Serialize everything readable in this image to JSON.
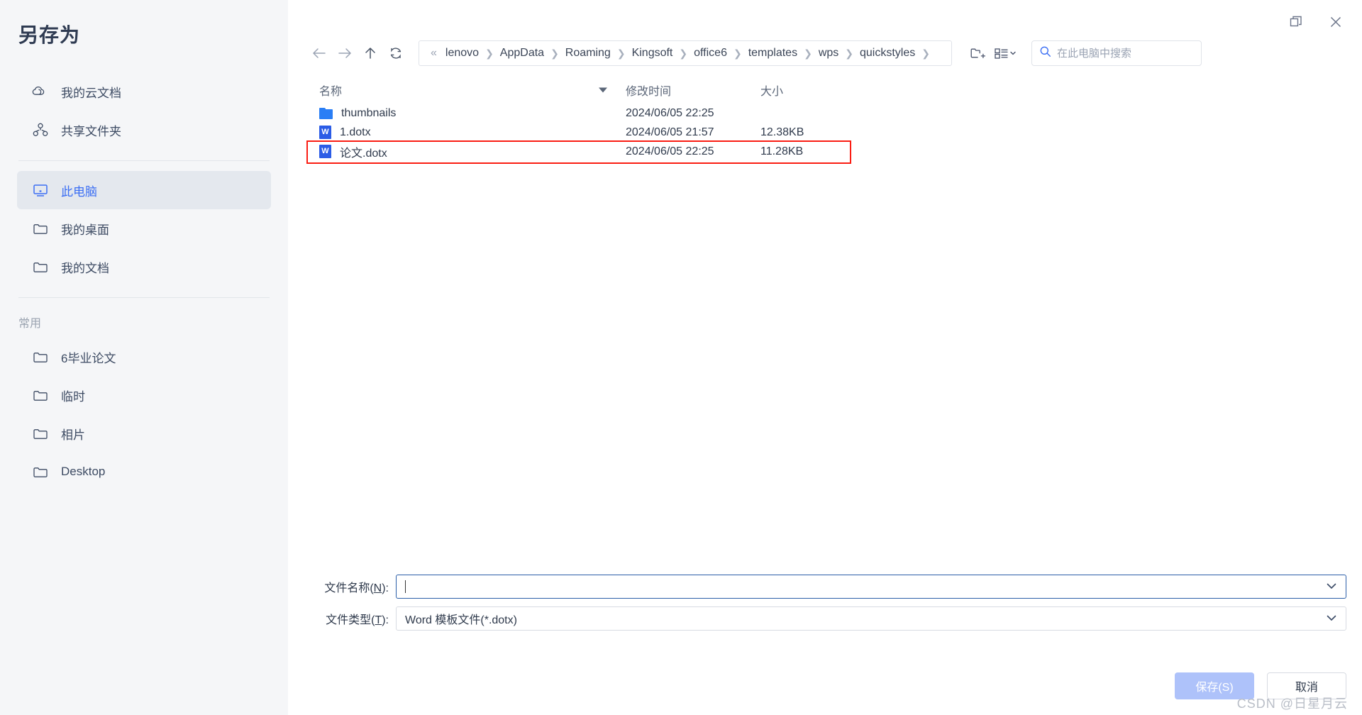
{
  "sidebar": {
    "title": "另存为",
    "top_items": [
      {
        "label": "我的云文档",
        "icon": "cloud-icon"
      },
      {
        "label": "共享文件夹",
        "icon": "share-nodes-icon"
      }
    ],
    "location_items": [
      {
        "label": "此电脑",
        "icon": "monitor-icon",
        "selected": true
      },
      {
        "label": "我的桌面",
        "icon": "folder-icon",
        "selected": false
      },
      {
        "label": "我的文档",
        "icon": "folder-icon",
        "selected": false
      }
    ],
    "section_label": "常用",
    "common_items": [
      {
        "label": "6毕业论文",
        "icon": "folder-icon"
      },
      {
        "label": "临时",
        "icon": "folder-icon"
      },
      {
        "label": "相片",
        "icon": "folder-icon"
      },
      {
        "label": "Desktop",
        "icon": "folder-icon"
      }
    ]
  },
  "window": {
    "restore_title": "还原",
    "close_title": "关闭"
  },
  "toolbar": {
    "back_title": "后退",
    "forward_title": "前进",
    "up_title": "向上",
    "refresh_title": "刷新",
    "crumb_prefix": "«",
    "breadcrumbs": [
      "lenovo",
      "AppData",
      "Roaming",
      "Kingsoft",
      "office6",
      "templates",
      "wps",
      "quickstyles"
    ],
    "new_folder_title": "新建文件夹",
    "view_title": "查看方式"
  },
  "search": {
    "placeholder": "在此电脑中搜索",
    "value": ""
  },
  "file_list": {
    "columns": {
      "name": "名称",
      "modified": "修改时间",
      "size": "大小"
    },
    "rows": [
      {
        "name": "thumbnails",
        "modified": "2024/06/05 22:25",
        "size": "",
        "icon": "folder-icon",
        "highlight": false
      },
      {
        "name": "1.dotx",
        "modified": "2024/06/05 21:57",
        "size": "12.38KB",
        "icon": "word-file-icon",
        "highlight": false
      },
      {
        "name": "论文.dotx",
        "modified": "2024/06/05 22:25",
        "size": "11.28KB",
        "icon": "word-file-icon",
        "highlight": true
      }
    ]
  },
  "form": {
    "filename_label_pre": "文件名称(",
    "filename_label_key": "N",
    "filename_label_post": "):",
    "filename_value": "",
    "filetype_label_pre": "文件类型(",
    "filetype_label_key": "T",
    "filetype_label_post": "):",
    "filetype_value": "Word 模板文件(*.dotx)"
  },
  "footer": {
    "save_label": "保存(S)",
    "cancel_label": "取消"
  },
  "watermark": "CSDN @日星月云",
  "colors": {
    "accent": "#3b6ef3",
    "sidebar_bg": "#f5f6f8",
    "selected_bg": "#e4e8ee",
    "highlight_border": "#fa1d13",
    "word_blue": "#2b5ce6",
    "folder_blue": "#2a7ef5",
    "save_button_bg": "#aec2fa"
  }
}
